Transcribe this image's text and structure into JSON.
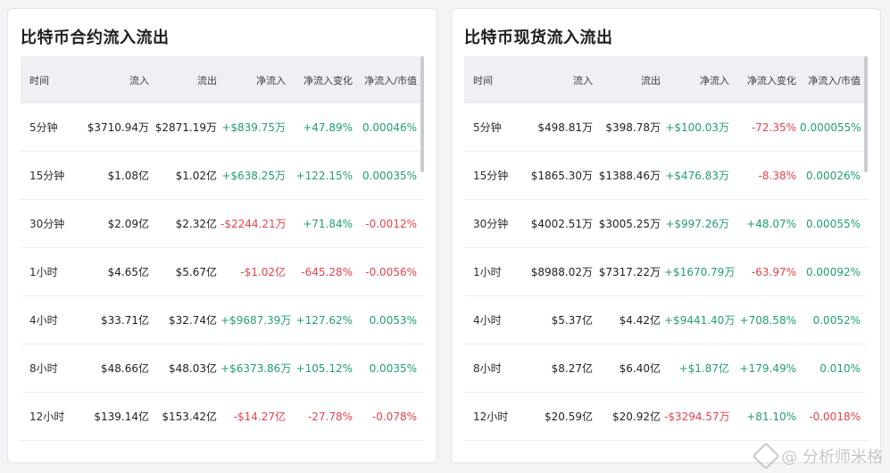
{
  "colors": {
    "up": "#22a06b",
    "down": "#e5424d",
    "panel_bg": "#ffffff",
    "header_bg": "#eef0f3"
  },
  "headers": [
    "时间",
    "流入",
    "流出",
    "净流入",
    "净流入变化",
    "净流入/市值"
  ],
  "contract": {
    "title": "比特币合约流入流出",
    "rows": [
      {
        "time": "5分钟",
        "inflow": "$3710.94万",
        "outflow": "$2871.19万",
        "net": "+$839.75万",
        "net_dir": "up",
        "change": "+47.89%",
        "change_dir": "up",
        "ratio": "0.00046%",
        "ratio_dir": "up"
      },
      {
        "time": "15分钟",
        "inflow": "$1.08亿",
        "outflow": "$1.02亿",
        "net": "+$638.25万",
        "net_dir": "up",
        "change": "+122.15%",
        "change_dir": "up",
        "ratio": "0.00035%",
        "ratio_dir": "up"
      },
      {
        "time": "30分钟",
        "inflow": "$2.09亿",
        "outflow": "$2.32亿",
        "net": "-$2244.21万",
        "net_dir": "down",
        "change": "+71.84%",
        "change_dir": "up",
        "ratio": "-0.0012%",
        "ratio_dir": "down"
      },
      {
        "time": "1小时",
        "inflow": "$4.65亿",
        "outflow": "$5.67亿",
        "net": "-$1.02亿",
        "net_dir": "down",
        "change": "-645.28%",
        "change_dir": "down",
        "ratio": "-0.0056%",
        "ratio_dir": "down"
      },
      {
        "time": "4小时",
        "inflow": "$33.71亿",
        "outflow": "$32.74亿",
        "net": "+$9687.39万",
        "net_dir": "up",
        "change": "+127.62%",
        "change_dir": "up",
        "ratio": "0.0053%",
        "ratio_dir": "up"
      },
      {
        "time": "8小时",
        "inflow": "$48.66亿",
        "outflow": "$48.03亿",
        "net": "+$6373.86万",
        "net_dir": "up",
        "change": "+105.12%",
        "change_dir": "up",
        "ratio": "0.0035%",
        "ratio_dir": "up"
      },
      {
        "time": "12小时",
        "inflow": "$139.14亿",
        "outflow": "$153.42亿",
        "net": "-$14.27亿",
        "net_dir": "down",
        "change": "-27.78%",
        "change_dir": "down",
        "ratio": "-0.078%",
        "ratio_dir": "down"
      }
    ]
  },
  "spot": {
    "title": "比特币现货流入流出",
    "rows": [
      {
        "time": "5分钟",
        "inflow": "$498.81万",
        "outflow": "$398.78万",
        "net": "+$100.03万",
        "net_dir": "up",
        "change": "-72.35%",
        "change_dir": "down",
        "ratio": "0.000055%",
        "ratio_dir": "up"
      },
      {
        "time": "15分钟",
        "inflow": "$1865.30万",
        "outflow": "$1388.46万",
        "net": "+$476.83万",
        "net_dir": "up",
        "change": "-8.38%",
        "change_dir": "down",
        "ratio": "0.00026%",
        "ratio_dir": "up"
      },
      {
        "time": "30分钟",
        "inflow": "$4002.51万",
        "outflow": "$3005.25万",
        "net": "+$997.26万",
        "net_dir": "up",
        "change": "+48.07%",
        "change_dir": "up",
        "ratio": "0.00055%",
        "ratio_dir": "up"
      },
      {
        "time": "1小时",
        "inflow": "$8988.02万",
        "outflow": "$7317.22万",
        "net": "+$1670.79万",
        "net_dir": "up",
        "change": "-63.97%",
        "change_dir": "down",
        "ratio": "0.00092%",
        "ratio_dir": "up"
      },
      {
        "time": "4小时",
        "inflow": "$5.37亿",
        "outflow": "$4.42亿",
        "net": "+$9441.40万",
        "net_dir": "up",
        "change": "+708.58%",
        "change_dir": "up",
        "ratio": "0.0052%",
        "ratio_dir": "up"
      },
      {
        "time": "8小时",
        "inflow": "$8.27亿",
        "outflow": "$6.40亿",
        "net": "+$1.87亿",
        "net_dir": "up",
        "change": "+179.49%",
        "change_dir": "up",
        "ratio": "0.010%",
        "ratio_dir": "up"
      },
      {
        "time": "12小时",
        "inflow": "$20.59亿",
        "outflow": "$20.92亿",
        "net": "-$3294.57万",
        "net_dir": "down",
        "change": "+81.10%",
        "change_dir": "up",
        "ratio": "-0.0018%",
        "ratio_dir": "down"
      }
    ]
  },
  "watermark": {
    "text": "@ 分析师米格",
    "icon": "diamond-logo-icon"
  }
}
